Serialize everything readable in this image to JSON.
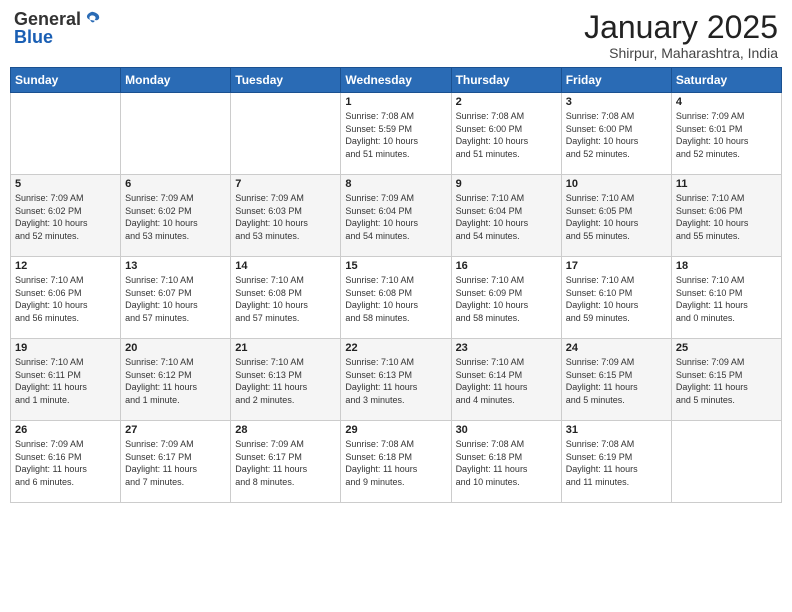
{
  "header": {
    "logo_general": "General",
    "logo_blue": "Blue",
    "month": "January 2025",
    "location": "Shirpur, Maharashtra, India"
  },
  "weekdays": [
    "Sunday",
    "Monday",
    "Tuesday",
    "Wednesday",
    "Thursday",
    "Friday",
    "Saturday"
  ],
  "weeks": [
    [
      {
        "day": "",
        "info": ""
      },
      {
        "day": "",
        "info": ""
      },
      {
        "day": "",
        "info": ""
      },
      {
        "day": "1",
        "info": "Sunrise: 7:08 AM\nSunset: 5:59 PM\nDaylight: 10 hours\nand 51 minutes."
      },
      {
        "day": "2",
        "info": "Sunrise: 7:08 AM\nSunset: 6:00 PM\nDaylight: 10 hours\nand 51 minutes."
      },
      {
        "day": "3",
        "info": "Sunrise: 7:08 AM\nSunset: 6:00 PM\nDaylight: 10 hours\nand 52 minutes."
      },
      {
        "day": "4",
        "info": "Sunrise: 7:09 AM\nSunset: 6:01 PM\nDaylight: 10 hours\nand 52 minutes."
      }
    ],
    [
      {
        "day": "5",
        "info": "Sunrise: 7:09 AM\nSunset: 6:02 PM\nDaylight: 10 hours\nand 52 minutes."
      },
      {
        "day": "6",
        "info": "Sunrise: 7:09 AM\nSunset: 6:02 PM\nDaylight: 10 hours\nand 53 minutes."
      },
      {
        "day": "7",
        "info": "Sunrise: 7:09 AM\nSunset: 6:03 PM\nDaylight: 10 hours\nand 53 minutes."
      },
      {
        "day": "8",
        "info": "Sunrise: 7:09 AM\nSunset: 6:04 PM\nDaylight: 10 hours\nand 54 minutes."
      },
      {
        "day": "9",
        "info": "Sunrise: 7:10 AM\nSunset: 6:04 PM\nDaylight: 10 hours\nand 54 minutes."
      },
      {
        "day": "10",
        "info": "Sunrise: 7:10 AM\nSunset: 6:05 PM\nDaylight: 10 hours\nand 55 minutes."
      },
      {
        "day": "11",
        "info": "Sunrise: 7:10 AM\nSunset: 6:06 PM\nDaylight: 10 hours\nand 55 minutes."
      }
    ],
    [
      {
        "day": "12",
        "info": "Sunrise: 7:10 AM\nSunset: 6:06 PM\nDaylight: 10 hours\nand 56 minutes."
      },
      {
        "day": "13",
        "info": "Sunrise: 7:10 AM\nSunset: 6:07 PM\nDaylight: 10 hours\nand 57 minutes."
      },
      {
        "day": "14",
        "info": "Sunrise: 7:10 AM\nSunset: 6:08 PM\nDaylight: 10 hours\nand 57 minutes."
      },
      {
        "day": "15",
        "info": "Sunrise: 7:10 AM\nSunset: 6:08 PM\nDaylight: 10 hours\nand 58 minutes."
      },
      {
        "day": "16",
        "info": "Sunrise: 7:10 AM\nSunset: 6:09 PM\nDaylight: 10 hours\nand 58 minutes."
      },
      {
        "day": "17",
        "info": "Sunrise: 7:10 AM\nSunset: 6:10 PM\nDaylight: 10 hours\nand 59 minutes."
      },
      {
        "day": "18",
        "info": "Sunrise: 7:10 AM\nSunset: 6:10 PM\nDaylight: 11 hours\nand 0 minutes."
      }
    ],
    [
      {
        "day": "19",
        "info": "Sunrise: 7:10 AM\nSunset: 6:11 PM\nDaylight: 11 hours\nand 1 minute."
      },
      {
        "day": "20",
        "info": "Sunrise: 7:10 AM\nSunset: 6:12 PM\nDaylight: 11 hours\nand 1 minute."
      },
      {
        "day": "21",
        "info": "Sunrise: 7:10 AM\nSunset: 6:13 PM\nDaylight: 11 hours\nand 2 minutes."
      },
      {
        "day": "22",
        "info": "Sunrise: 7:10 AM\nSunset: 6:13 PM\nDaylight: 11 hours\nand 3 minutes."
      },
      {
        "day": "23",
        "info": "Sunrise: 7:10 AM\nSunset: 6:14 PM\nDaylight: 11 hours\nand 4 minutes."
      },
      {
        "day": "24",
        "info": "Sunrise: 7:09 AM\nSunset: 6:15 PM\nDaylight: 11 hours\nand 5 minutes."
      },
      {
        "day": "25",
        "info": "Sunrise: 7:09 AM\nSunset: 6:15 PM\nDaylight: 11 hours\nand 5 minutes."
      }
    ],
    [
      {
        "day": "26",
        "info": "Sunrise: 7:09 AM\nSunset: 6:16 PM\nDaylight: 11 hours\nand 6 minutes."
      },
      {
        "day": "27",
        "info": "Sunrise: 7:09 AM\nSunset: 6:17 PM\nDaylight: 11 hours\nand 7 minutes."
      },
      {
        "day": "28",
        "info": "Sunrise: 7:09 AM\nSunset: 6:17 PM\nDaylight: 11 hours\nand 8 minutes."
      },
      {
        "day": "29",
        "info": "Sunrise: 7:08 AM\nSunset: 6:18 PM\nDaylight: 11 hours\nand 9 minutes."
      },
      {
        "day": "30",
        "info": "Sunrise: 7:08 AM\nSunset: 6:18 PM\nDaylight: 11 hours\nand 10 minutes."
      },
      {
        "day": "31",
        "info": "Sunrise: 7:08 AM\nSunset: 6:19 PM\nDaylight: 11 hours\nand 11 minutes."
      },
      {
        "day": "",
        "info": ""
      }
    ]
  ]
}
